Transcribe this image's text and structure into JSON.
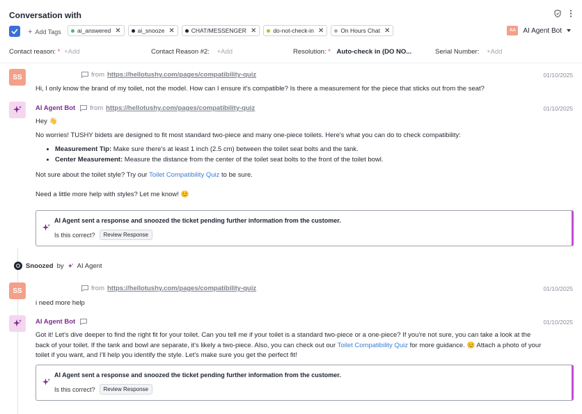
{
  "header": {
    "title": "Conversation with",
    "add_tags": "Add Tags",
    "tags": [
      {
        "label": "ai_answered",
        "color": "#4cb782"
      },
      {
        "label": "ai_snooze",
        "color": "#1f2430"
      },
      {
        "label": "CHAT/MESSENGER",
        "color": "#1f2430"
      },
      {
        "label": "do-not-check-in",
        "color": "#9acd32"
      },
      {
        "label": "On Hours Chat",
        "color": "#a8adb6"
      }
    ],
    "agent": {
      "initials": "AA",
      "name": "AI Agent Bot"
    }
  },
  "fields": {
    "contact_reason_label": "Contact reason:",
    "contact_reason_add": "+Add",
    "contact_reason2_label": "Contact Reason #2:",
    "contact_reason2_add": "+Add",
    "resolution_label": "Resolution:",
    "resolution_value": "Auto-check in (DO NO...",
    "serial_label": "Serial Number:",
    "serial_add": "+Add"
  },
  "messages": {
    "m1": {
      "initials": "SS",
      "from": "from",
      "url": "https://hellotushy.com/pages/compatibility-quiz",
      "date": "01/10/2025",
      "text": "Hi, I only know the brand of my toilet, not the model. How can I ensure it's compatible? Is there a measurement for the piece that sticks out from the seat?"
    },
    "m2": {
      "sender": "AI Agent Bot",
      "from": "from",
      "url": "https://hellotushy.com/pages/compatibility-quiz",
      "date": "01/10/2025",
      "greeting": "Hey 👋",
      "intro": "No worries! TUSHY bidets are designed to fit most standard two-piece and many one-piece toilets. Here's what you can do to check compatibility:",
      "bullet1_label": "Measurement Tip:",
      "bullet1_text": "Make sure there's at least 1 inch (2.5 cm) between the toilet seat bolts and the tank.",
      "bullet2_label": "Center Measurement:",
      "bullet2_text": "Measure the distance from the center of the toilet seat bolts to the front of the toilet bowl.",
      "quiz_pre": "Not sure about the toilet style? Try our",
      "quiz_link": "Toilet Compatibility Quiz",
      "quiz_post": "to be sure.",
      "closing": "Need a little more help with styles? Let me know! 😊",
      "card_title": "AI Agent sent a response and snoozed the ticket pending further information from the customer.",
      "card_question": "Is this correct?",
      "card_button": "Review Response"
    },
    "snooze": {
      "label": "Snoozed",
      "by": "by",
      "agent": "AI Agent"
    },
    "m3": {
      "initials": "SS",
      "from": "from",
      "url": "https://hellotushy.com/pages/compatibility-quiz",
      "date": "01/10/2025",
      "text": "i need more help"
    },
    "m4": {
      "sender": "AI Agent Bot",
      "date": "01/10/2025",
      "line1": "Got it! Let's dive deeper to find the right fit for your toilet. Can you tell me if your toilet is a standard two-piece or a one-piece? If you're not sure, you can take a look at the",
      "line2_pre": "back of your toilet. If the tank and bowl are separate, it's likely a two-piece. Also, you can check out our",
      "line2_link": "Toilet Compatibility Quiz",
      "line2_post": "for more guidance. 😊 Attach a photo of your",
      "line3": "toilet if you want, and I'll help you identify the style. Let's make sure you get the perfect fit!",
      "card_title": "AI Agent sent a response and snoozed the ticket pending further information from the customer.",
      "card_question": "Is this correct?",
      "card_button": "Review Response"
    }
  },
  "colors": {
    "accent": "#3b6fd8",
    "ai_purple": "#7a2e8c",
    "card_border": "#c24dd1",
    "avatar_ss": "#f3a08a"
  }
}
